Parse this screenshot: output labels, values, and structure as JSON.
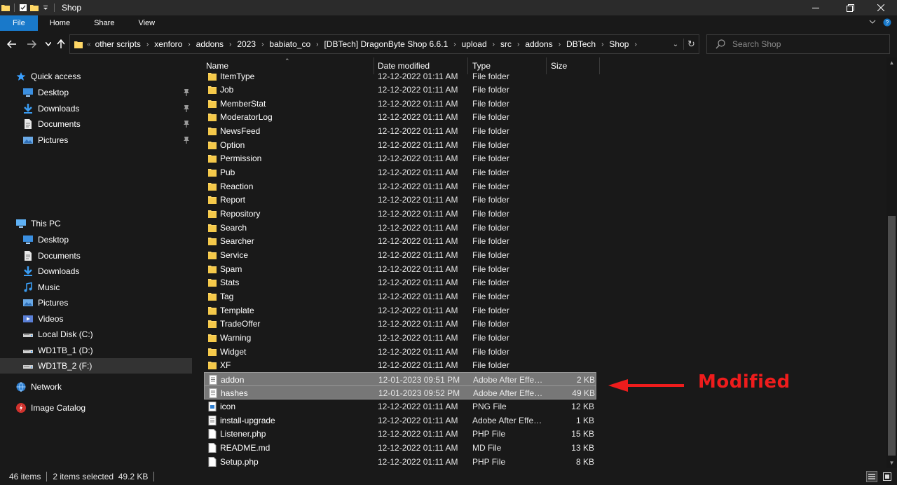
{
  "window": {
    "title": "Shop",
    "controls": [
      "minimize-icon",
      "maximize-icon",
      "close-icon"
    ]
  },
  "ribbon": {
    "tabs": [
      "File",
      "Home",
      "Share",
      "View"
    ]
  },
  "nav_buttons": [
    "back-arrow-icon",
    "forward-arrow-icon",
    "recent-dropdown-icon",
    "up-arrow-icon"
  ],
  "address": {
    "overflow": "«",
    "crumbs": [
      "other scripts",
      "xenforo",
      "addons",
      "2023",
      "babiato_co",
      "[DBTech] DragonByte Shop 6.6.1",
      "upload",
      "src",
      "addons",
      "DBTech",
      "Shop"
    ]
  },
  "search": {
    "placeholder": "Search Shop"
  },
  "nav": {
    "quick_access": {
      "label": "Quick access",
      "items": [
        {
          "label": "Desktop",
          "icon": "desktop-icon",
          "pinned": true
        },
        {
          "label": "Downloads",
          "icon": "downloads-icon",
          "pinned": true
        },
        {
          "label": "Documents",
          "icon": "documents-icon",
          "pinned": true
        },
        {
          "label": "Pictures",
          "icon": "pictures-icon",
          "pinned": true
        }
      ]
    },
    "this_pc": {
      "label": "This PC",
      "items": [
        {
          "label": "Desktop",
          "icon": "desktop-icon"
        },
        {
          "label": "Documents",
          "icon": "documents-icon"
        },
        {
          "label": "Downloads",
          "icon": "downloads-icon"
        },
        {
          "label": "Music",
          "icon": "music-icon"
        },
        {
          "label": "Pictures",
          "icon": "pictures-icon"
        },
        {
          "label": "Videos",
          "icon": "videos-icon"
        },
        {
          "label": "Local Disk (C:)",
          "icon": "drive-icon"
        },
        {
          "label": "WD1TB_1 (D:)",
          "icon": "drive-icon"
        },
        {
          "label": "WD1TB_2 (F:)",
          "icon": "drive-icon",
          "selected": true
        }
      ]
    },
    "network": {
      "label": "Network"
    },
    "image_catalog": {
      "label": "Image Catalog"
    }
  },
  "columns": {
    "name": "Name",
    "date": "Date modified",
    "type": "Type",
    "size": "Size"
  },
  "files": [
    {
      "name": "ItemType",
      "date": "12-12-2022 01:11 AM",
      "type": "File folder",
      "size": "",
      "kind": "folder"
    },
    {
      "name": "Job",
      "date": "12-12-2022 01:11 AM",
      "type": "File folder",
      "size": "",
      "kind": "folder"
    },
    {
      "name": "MemberStat",
      "date": "12-12-2022 01:11 AM",
      "type": "File folder",
      "size": "",
      "kind": "folder"
    },
    {
      "name": "ModeratorLog",
      "date": "12-12-2022 01:11 AM",
      "type": "File folder",
      "size": "",
      "kind": "folder"
    },
    {
      "name": "NewsFeed",
      "date": "12-12-2022 01:11 AM",
      "type": "File folder",
      "size": "",
      "kind": "folder"
    },
    {
      "name": "Option",
      "date": "12-12-2022 01:11 AM",
      "type": "File folder",
      "size": "",
      "kind": "folder"
    },
    {
      "name": "Permission",
      "date": "12-12-2022 01:11 AM",
      "type": "File folder",
      "size": "",
      "kind": "folder"
    },
    {
      "name": "Pub",
      "date": "12-12-2022 01:11 AM",
      "type": "File folder",
      "size": "",
      "kind": "folder"
    },
    {
      "name": "Reaction",
      "date": "12-12-2022 01:11 AM",
      "type": "File folder",
      "size": "",
      "kind": "folder"
    },
    {
      "name": "Report",
      "date": "12-12-2022 01:11 AM",
      "type": "File folder",
      "size": "",
      "kind": "folder"
    },
    {
      "name": "Repository",
      "date": "12-12-2022 01:11 AM",
      "type": "File folder",
      "size": "",
      "kind": "folder"
    },
    {
      "name": "Search",
      "date": "12-12-2022 01:11 AM",
      "type": "File folder",
      "size": "",
      "kind": "folder"
    },
    {
      "name": "Searcher",
      "date": "12-12-2022 01:11 AM",
      "type": "File folder",
      "size": "",
      "kind": "folder"
    },
    {
      "name": "Service",
      "date": "12-12-2022 01:11 AM",
      "type": "File folder",
      "size": "",
      "kind": "folder"
    },
    {
      "name": "Spam",
      "date": "12-12-2022 01:11 AM",
      "type": "File folder",
      "size": "",
      "kind": "folder"
    },
    {
      "name": "Stats",
      "date": "12-12-2022 01:11 AM",
      "type": "File folder",
      "size": "",
      "kind": "folder"
    },
    {
      "name": "Tag",
      "date": "12-12-2022 01:11 AM",
      "type": "File folder",
      "size": "",
      "kind": "folder"
    },
    {
      "name": "Template",
      "date": "12-12-2022 01:11 AM",
      "type": "File folder",
      "size": "",
      "kind": "folder"
    },
    {
      "name": "TradeOffer",
      "date": "12-12-2022 01:11 AM",
      "type": "File folder",
      "size": "",
      "kind": "folder"
    },
    {
      "name": "Warning",
      "date": "12-12-2022 01:11 AM",
      "type": "File folder",
      "size": "",
      "kind": "folder"
    },
    {
      "name": "Widget",
      "date": "12-12-2022 01:11 AM",
      "type": "File folder",
      "size": "",
      "kind": "folder"
    },
    {
      "name": "XF",
      "date": "12-12-2022 01:11 AM",
      "type": "File folder",
      "size": "",
      "kind": "folder"
    },
    {
      "name": "addon",
      "date": "12-01-2023 09:51 PM",
      "type": "Adobe After Effect...",
      "size": "2 KB",
      "kind": "doc",
      "selected": true
    },
    {
      "name": "hashes",
      "date": "12-01-2023 09:52 PM",
      "type": "Adobe After Effect...",
      "size": "49 KB",
      "kind": "doc",
      "selected": true
    },
    {
      "name": "icon",
      "date": "12-12-2022 01:11 AM",
      "type": "PNG File",
      "size": "12 KB",
      "kind": "image"
    },
    {
      "name": "install-upgrade",
      "date": "12-12-2022 01:11 AM",
      "type": "Adobe After Effect...",
      "size": "1 KB",
      "kind": "doc"
    },
    {
      "name": "Listener.php",
      "date": "12-12-2022 01:11 AM",
      "type": "PHP File",
      "size": "15 KB",
      "kind": "file"
    },
    {
      "name": "README.md",
      "date": "12-12-2022 01:11 AM",
      "type": "MD File",
      "size": "13 KB",
      "kind": "file"
    },
    {
      "name": "Setup.php",
      "date": "12-12-2022 01:11 AM",
      "type": "PHP File",
      "size": "8 KB",
      "kind": "file"
    }
  ],
  "status": {
    "items": "46 items",
    "selection": "2 items selected  49.2 KB"
  },
  "annotation": {
    "text": "Modified",
    "color": "#ee1c1c"
  },
  "colors": {
    "folder": "#ffd766",
    "accent": "#1979ca",
    "selection": "#777777"
  }
}
